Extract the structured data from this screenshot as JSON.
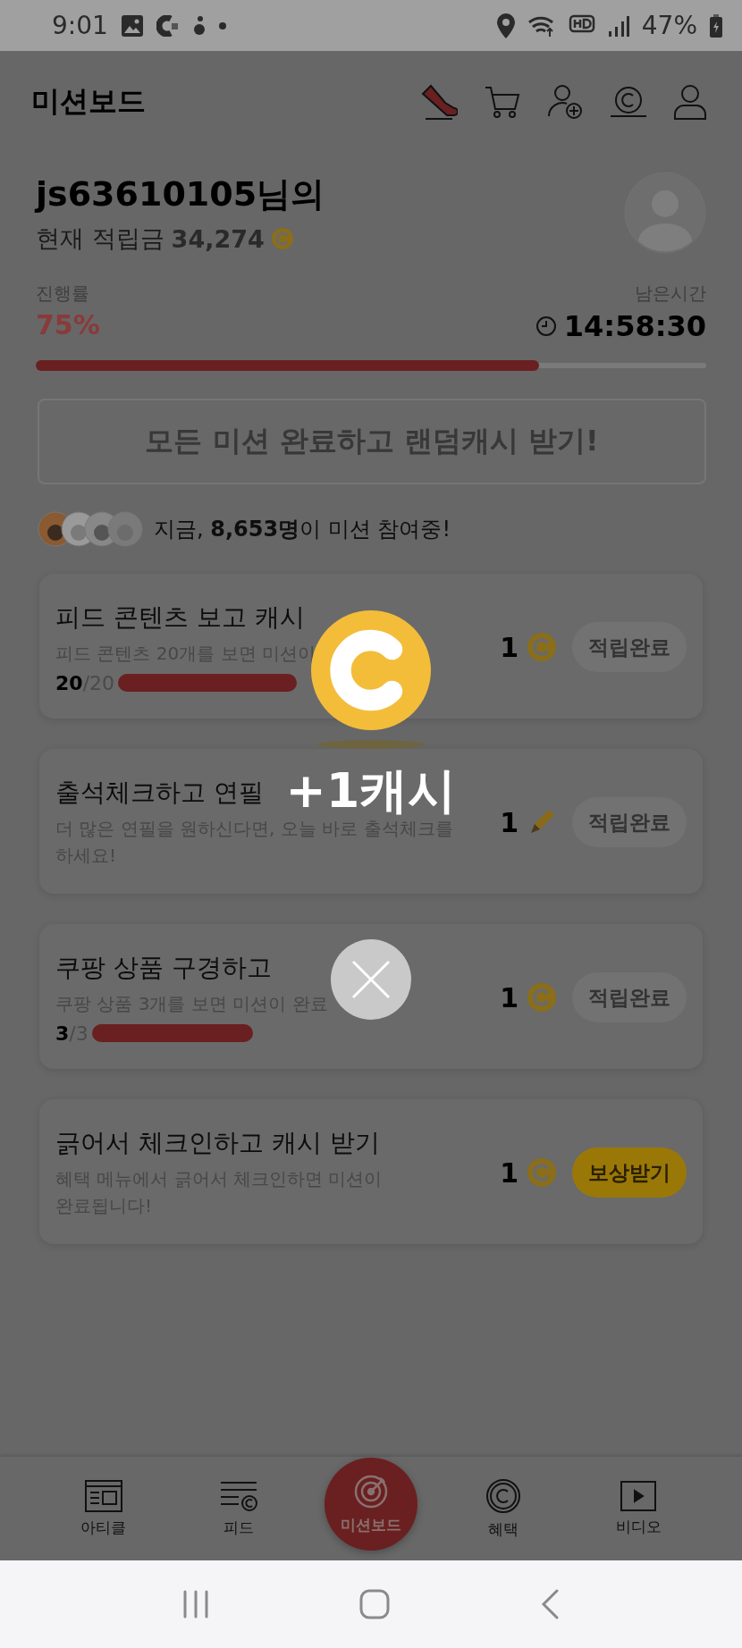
{
  "status_bar": {
    "time": "9:01",
    "battery": "47%"
  },
  "header": {
    "title": "미션보드"
  },
  "user": {
    "name": "js63610105님의",
    "balance_label": "현재 적립금",
    "balance": "34,274"
  },
  "progress": {
    "label": "진행률",
    "percent": "75%",
    "level": 0.75,
    "remaining_label": "남은시간",
    "remaining": "14:58:30"
  },
  "bonus_button": {
    "label": "모든 미션 완료하고 랜덤캐시 받기!",
    "disabled": true
  },
  "participants": {
    "text": "지금, **8,653명**이 미션 참여중!"
  },
  "missions": [
    {
      "title": "피드 콘텐츠 보고 캐시",
      "description": "피드 콘텐츠 20개를 보면 미션이",
      "count": "**20**/20",
      "reward": "1",
      "kind": "coin",
      "button": "적립완료",
      "completed": true
    },
    {
      "title": "출석체크하고 연필",
      "description": "더 많은 연필을 원하신다면, 오늘 바로 출석체크를 하세요!",
      "reward": "1",
      "kind": "pencil",
      "button": "적립완료",
      "completed": true
    },
    {
      "title": "쿠팡 상품 구경하고",
      "description": "쿠팡 상품 3개를 보면 미션이 완료",
      "count": "**3**/3",
      "reward": "1",
      "kind": "coin",
      "button": "적립완료",
      "completed": true
    },
    {
      "title": "긁어서 체크인하고 캐시 받기",
      "description": "혜택 메뉴에서 긁어서 체크인하면 미션이 완료됩니다!",
      "reward": "1",
      "kind": "coin",
      "button": "보상받기",
      "completed": false
    }
  ],
  "reward_popup": {
    "amount": "+1캐시"
  },
  "bottom_nav": [
    {
      "label": "아티클",
      "selected": false
    },
    {
      "label": "피드",
      "selected": false
    },
    {
      "label": "미션보드",
      "selected": true
    },
    {
      "label": "혜택",
      "selected": false
    },
    {
      "label": "비디오",
      "selected": false
    }
  ]
}
